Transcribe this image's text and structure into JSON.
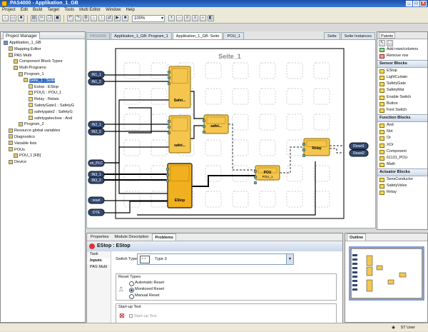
{
  "window": {
    "title": "PAS4000 - Applikation_1_GB",
    "controls": [
      "_",
      "□",
      "X"
    ]
  },
  "menu": [
    "Project",
    "Edit",
    "Build",
    "Target",
    "Tools",
    "Multi Editor",
    "Window",
    "Help"
  ],
  "toolbar": {
    "zoom": "100%"
  },
  "project_manager": {
    "tab": "Project Manager",
    "tree": [
      {
        "label": "Applikation_1_GB",
        "indent": 0
      },
      {
        "label": "Mapping Editor",
        "indent": 1
      },
      {
        "label": "PAS Multi",
        "indent": 1
      },
      {
        "label": "Component Block Types",
        "indent": 2
      },
      {
        "label": "Multi Programs",
        "indent": 2
      },
      {
        "label": "Program_1",
        "indent": 3
      },
      {
        "label": "Seite_1 : Seite",
        "indent": 4
      },
      {
        "label": "Estop : EStop",
        "indent": 5
      },
      {
        "label": "POU1 : POU_1",
        "indent": 5
      },
      {
        "label": "Relay : Relais",
        "indent": 5
      },
      {
        "label": "SafetyGate1 : SafetyG",
        "indent": 5
      },
      {
        "label": "safetygate2 : SafetyG",
        "indent": 5
      },
      {
        "label": "safetygateclose : And",
        "indent": 5
      },
      {
        "label": "Program_2",
        "indent": 3
      },
      {
        "label": "Resource global variables",
        "indent": 1
      },
      {
        "label": "Diagnostics",
        "indent": 1
      },
      {
        "label": "Variable lists",
        "indent": 1
      },
      {
        "label": "POUs",
        "indent": 1
      },
      {
        "label": "POU_1 [FB]",
        "indent": 2
      },
      {
        "label": "Device",
        "indent": 1
      }
    ]
  },
  "editor": {
    "tabs": [
      "Applikation_1_GB: Program_1",
      "Applikation_1_GB: Seite",
      "POU_1"
    ],
    "active_tab": 1,
    "breadcrumb": "PAS4000",
    "page_title": "Seite_1",
    "right_tabs": [
      "Seite",
      "Seite Instances"
    ],
    "inputs_left": [
      "IN1_1",
      "IN1_2",
      "IN2_1",
      "IN2_2",
      "en_PLC",
      "IN3_1",
      "IN3_2",
      "reset",
      "DTE"
    ],
    "outputs_right": [
      "Reset1",
      "Reset2"
    ],
    "blocks": [
      {
        "title": "Safet...",
        "kind": "safetygate"
      },
      {
        "title": "safet...",
        "kind": "and"
      },
      {
        "title": "safet...",
        "kind": "safetygate"
      },
      {
        "title": "EStop",
        "kind": "estop"
      },
      {
        "title": "POU",
        "subtitle": "POU_1",
        "kind": "pou"
      },
      {
        "title": "Relay",
        "kind": "relay"
      }
    ]
  },
  "palette": {
    "title": "Palette",
    "tools": [
      "Add rows/columns",
      "Remove row"
    ],
    "drawers": [
      {
        "name": "Sensor Blocks",
        "items": [
          "EStop",
          "LightCurtain",
          "SafetyGate",
          "SafetyMat",
          "Enable Switch",
          "Button",
          "Foot Switch"
        ]
      },
      {
        "name": "Function Blocks",
        "items": [
          "And",
          "Not",
          "Or",
          "XOr",
          "Component",
          "61131_POU",
          "Math"
        ]
      },
      {
        "name": "Actuator Blocks",
        "items": [
          "SensConductor",
          "SafetyValve",
          "Relay"
        ]
      }
    ]
  },
  "bottom": {
    "tabs": [
      "Properties",
      "Module Description",
      "Problems"
    ],
    "active_tab": 2,
    "title": "EStop : EStop",
    "side_items": [
      "Task",
      "Inputs",
      "PAS Multi"
    ],
    "active_side": 1,
    "switch_type_label": "Switch Type:",
    "switch_type_value": "Type 3",
    "reset_types_label": "Reset Types",
    "reset_options": [
      "Automatic Reset",
      "Monitored Reset",
      "Manual Reset"
    ],
    "reset_selected": 1,
    "startup_label": "Start-up Test",
    "startup_checkbox": "Start-up Test"
  },
  "outline": {
    "tab": "Outline"
  },
  "status": {
    "user": "ST User"
  },
  "colors": {
    "block_fill": "#f5c64f",
    "block_border": "#8a6a00",
    "selected_fill": "#f1b01f",
    "wire": "#000000",
    "dashed_wire": "#555555",
    "title_blue": "#1c4fa8"
  }
}
